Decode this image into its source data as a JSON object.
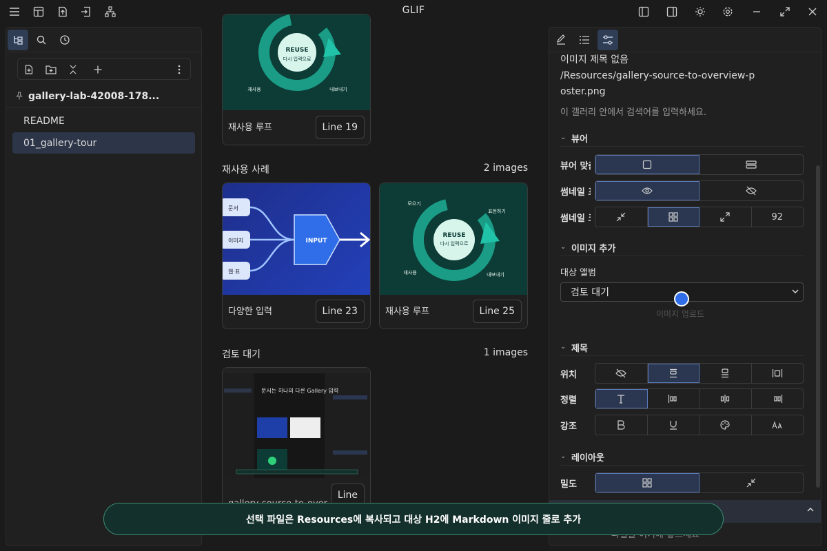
{
  "app": {
    "title": "GLIF"
  },
  "titlebar": {
    "left_icons": [
      "menu-icon",
      "layout-icon",
      "export-icon",
      "import-icon",
      "hierarchy-icon"
    ],
    "right_icons": [
      "left-panel-icon",
      "right-panel-icon",
      "brightness-icon",
      "gear-icon",
      "minimize-icon",
      "maximize-icon",
      "close-icon"
    ]
  },
  "sidebar": {
    "vault_name": "gallery-lab-42008-178...",
    "files": [
      "README",
      "01_gallery-tour"
    ],
    "active_file": "01_gallery-tour"
  },
  "gallery": {
    "top_card": {
      "caption": "재사용 루프",
      "line": "Line 19",
      "labels": {
        "reuse": "REUSE",
        "sub": "다시 입력으로",
        "left": "재사용",
        "right": "내보내기"
      }
    },
    "sections": [
      {
        "name": "재사용 사례",
        "count": "2 images",
        "cards": [
          {
            "caption": "다양한 입력",
            "line": "Line 23",
            "labels": {
              "doc": "문서",
              "img": "이미지",
              "web": "웹·표",
              "input": "INPUT"
            }
          },
          {
            "caption": "재사용 루프",
            "line": "Line 25",
            "labels": {
              "top_left": "모으기",
              "top_right": "표현하기",
              "reuse": "REUSE",
              "sub": "다시 입력으로",
              "left": "재사용",
              "right": "내보내기"
            }
          }
        ]
      },
      {
        "name": "검토 대기",
        "count": "1 images",
        "cards": [
          {
            "caption": "gallery-source-to-over",
            "line": "Line",
            "labels": {
              "heading": "문서는 하나의 다른 Gallery 입력"
            }
          }
        ]
      }
    ]
  },
  "right_panel": {
    "tabs": [
      "edit-icon",
      "list-icon",
      "sliders-icon"
    ],
    "image_title": "이미지 제목 없음",
    "image_path": "/Resources/gallery-source-to-overview-poster.png",
    "search_hint": "이 갤러리 안에서 검색어를 입력하세요.",
    "viewer_section": "뷰어",
    "viewer_fit_label": "뷰어 맞춤",
    "thumb_label_1": "썸네일 표시",
    "thumb_label_2": "썸네일 크기",
    "thumb_size_value": "92",
    "add_section": "이미지 추가",
    "target_album_label": "대상 앨범",
    "target_album_value": "검토 대기",
    "upload_hint": "이미지 업로드",
    "title_section": "제목",
    "position_label": "위치",
    "align_label": "정렬",
    "emphasis_label": "강조",
    "layout_section": "레이아웃",
    "density_label": "밀도",
    "drop_hint": "파일을 여기에 놓으세요"
  },
  "toast": {
    "text": "선택 파일은 Resources에 복사되고 대상 H2에 Markdown 이미지 줄로 추가"
  },
  "colors": {
    "accent": "#5a78b8",
    "selected_bg": "#2b3750",
    "toast_border": "#3c8d70",
    "toast_bg": "#14302c",
    "reuse_teal": "#1fb5a0",
    "input_blue": "#2f6ee8"
  }
}
